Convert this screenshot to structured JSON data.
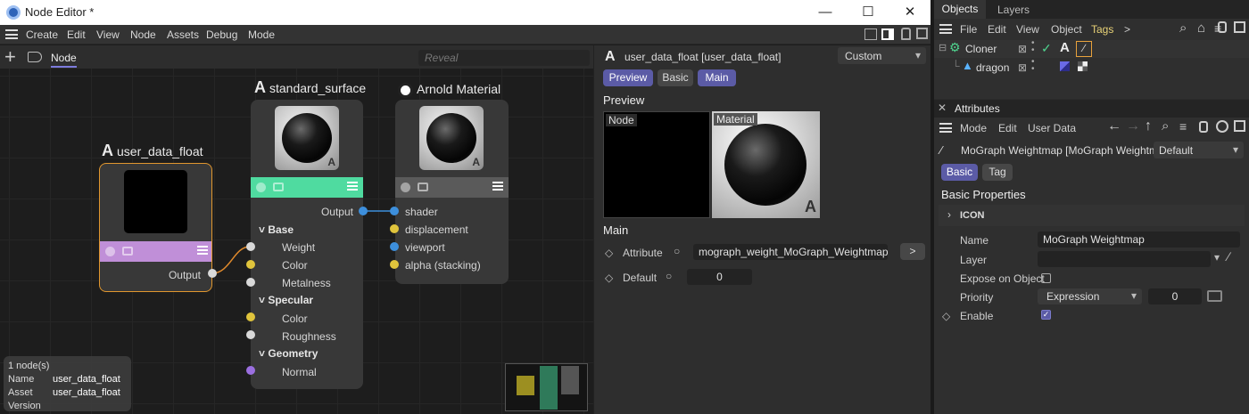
{
  "window": {
    "title": "Node Editor *",
    "minimize": "—",
    "maximize": "☐",
    "close": "✕"
  },
  "menu": [
    "Create",
    "Edit",
    "View",
    "Node",
    "Assets",
    "Debug",
    "Mode"
  ],
  "toolbar": {
    "add": "+",
    "tab": "Node",
    "reveal_placeholder": "Reveal"
  },
  "nodes": {
    "user_data_float": {
      "icon": "A",
      "title": "user_data_float",
      "output": "Output",
      "bar_color": "#c08fd8"
    },
    "standard_surface": {
      "icon": "A",
      "title": "standard_surface",
      "output": "Output",
      "bar_color": "#4fdba0",
      "groups": [
        {
          "name": "Base",
          "ports": [
            {
              "label": "Weight",
              "color": "#d9d9d9"
            },
            {
              "label": "Color",
              "color": "#e0c43c"
            },
            {
              "label": "Metalness",
              "color": "#d9d9d9"
            }
          ]
        },
        {
          "name": "Specular",
          "ports": [
            {
              "label": "Color",
              "color": "#e0c43c"
            },
            {
              "label": "Roughness",
              "color": "#d9d9d9"
            }
          ]
        },
        {
          "name": "Geometry",
          "ports": [
            {
              "label": "Normal",
              "color": "#9b6fe0"
            }
          ]
        }
      ]
    },
    "arnold_material": {
      "title": "Arnold Material",
      "bar_color": "#5a5a5a",
      "ports": [
        {
          "label": "shader",
          "color": "#3d8fdc"
        },
        {
          "label": "displacement",
          "color": "#e0c43c"
        },
        {
          "label": "viewport",
          "color": "#3d8fdc"
        },
        {
          "label": "alpha (stacking)",
          "color": "#e0c43c"
        }
      ]
    }
  },
  "info": {
    "count": "1 node(s)",
    "name_label": "Name",
    "name_value": "user_data_float",
    "asset_label": "Asset",
    "asset_value": "user_data_float",
    "version_label": "Version"
  },
  "node_attr": {
    "header": "user_data_float [user_data_float]",
    "mode": "Custom",
    "tabs": [
      "Preview",
      "Basic",
      "Main"
    ],
    "preview_heading": "Preview",
    "preview_node": "Node",
    "preview_material": "Material",
    "main_heading": "Main",
    "attribute_label": "Attribute",
    "attribute_value": "mograph_weight_MoGraph_Weightmap",
    "arrow_btn": ">",
    "default_label": "Default",
    "default_value": "0"
  },
  "objects": {
    "tabs": [
      "Objects",
      "Layers"
    ],
    "menu": [
      "File",
      "Edit",
      "View",
      "Object",
      "Tags"
    ],
    "more": ">",
    "items": [
      {
        "name": "Cloner"
      },
      {
        "name": "dragon"
      }
    ]
  },
  "attributes": {
    "title": "Attributes",
    "menu": [
      "Mode",
      "Edit",
      "User Data"
    ],
    "object": "MoGraph Weightmap [MoGraph Weightm..",
    "preset": "Default",
    "tabs": [
      "Basic",
      "Tag"
    ],
    "section": "Basic Properties",
    "icon_group": "ICON",
    "name_label": "Name",
    "name_value": "MoGraph Weightmap",
    "layer_label": "Layer",
    "expose_label": "Expose on Object",
    "priority_label": "Priority",
    "priority_value": "Expression",
    "priority_num": "0",
    "enable_label": "Enable"
  }
}
